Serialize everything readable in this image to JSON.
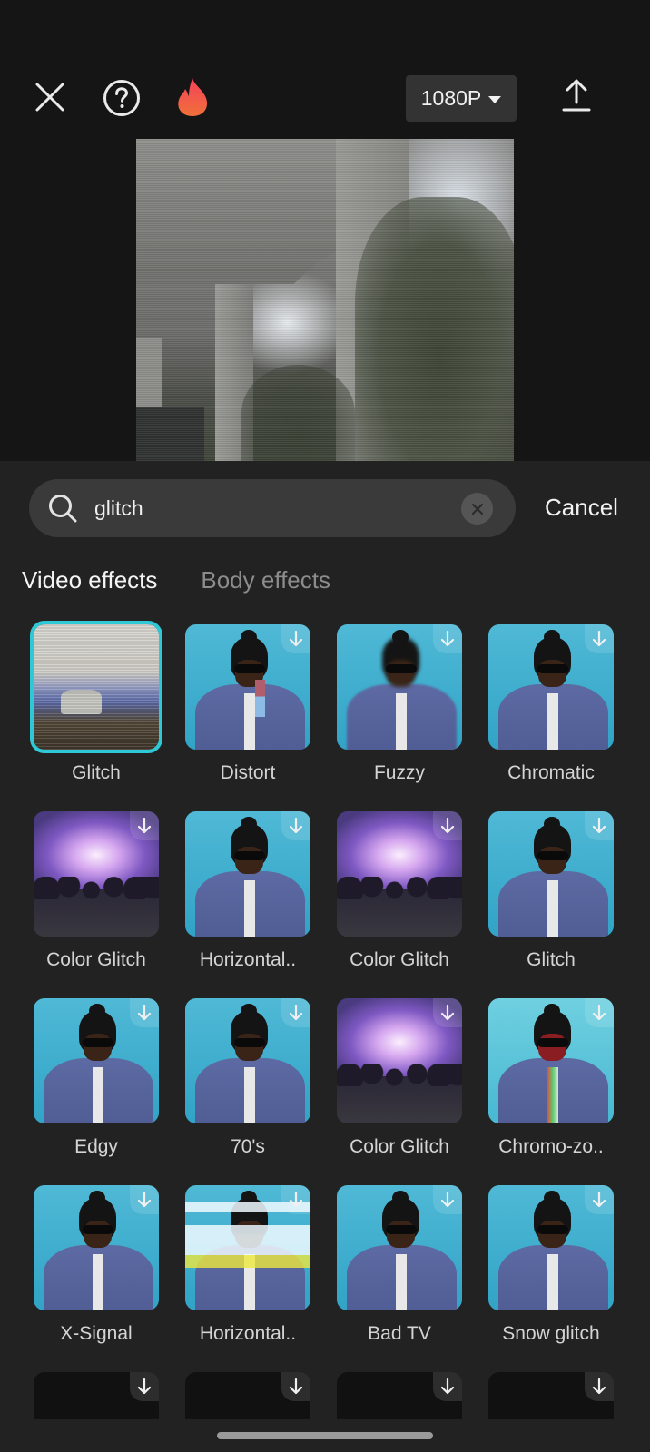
{
  "toolbar": {
    "close_icon": "close-icon",
    "help_icon": "help-icon",
    "promo_icon": "fire-icon",
    "resolution": "1080P",
    "export_icon": "upload-icon"
  },
  "preview": {
    "description": "Video preview with glitch effect applied"
  },
  "search": {
    "value": "glitch",
    "placeholder": "",
    "clear_icon": "clear-icon",
    "cancel_label": "Cancel"
  },
  "tabs": [
    {
      "label": "Video effects",
      "active": true
    },
    {
      "label": "Body effects",
      "active": false
    }
  ],
  "effects": [
    {
      "label": "Glitch",
      "selected": true,
      "downloadable": false,
      "thumb": "snow"
    },
    {
      "label": "Distort",
      "selected": false,
      "downloadable": true,
      "thumb": "person"
    },
    {
      "label": "Fuzzy",
      "selected": false,
      "downloadable": true,
      "thumb": "person"
    },
    {
      "label": "Chromatic",
      "selected": false,
      "downloadable": true,
      "thumb": "person"
    },
    {
      "label": "Color Glitch",
      "selected": false,
      "downloadable": true,
      "thumb": "crowd"
    },
    {
      "label": "Horizontal..",
      "selected": false,
      "downloadable": true,
      "thumb": "person"
    },
    {
      "label": "Color Glitch",
      "selected": false,
      "downloadable": true,
      "thumb": "crowd"
    },
    {
      "label": "Glitch",
      "selected": false,
      "downloadable": true,
      "thumb": "person"
    },
    {
      "label": "Edgy",
      "selected": false,
      "downloadable": true,
      "thumb": "person"
    },
    {
      "label": "70's",
      "selected": false,
      "downloadable": true,
      "thumb": "person"
    },
    {
      "label": "Color Glitch",
      "selected": false,
      "downloadable": true,
      "thumb": "crowd"
    },
    {
      "label": "Chromo-zo..",
      "selected": false,
      "downloadable": true,
      "thumb": "person"
    },
    {
      "label": "X-Signal",
      "selected": false,
      "downloadable": true,
      "thumb": "person"
    },
    {
      "label": "Horizontal..",
      "selected": false,
      "downloadable": true,
      "thumb": "person"
    },
    {
      "label": "Bad TV",
      "selected": false,
      "downloadable": true,
      "thumb": "person"
    },
    {
      "label": "Snow glitch",
      "selected": false,
      "downloadable": true,
      "thumb": "person"
    }
  ],
  "colors": {
    "background": "#222222",
    "top_background": "#151515",
    "selection_accent": "#2fc8d6",
    "fire_gradient_top": "#f5415a",
    "fire_gradient_bottom": "#f0703a"
  }
}
